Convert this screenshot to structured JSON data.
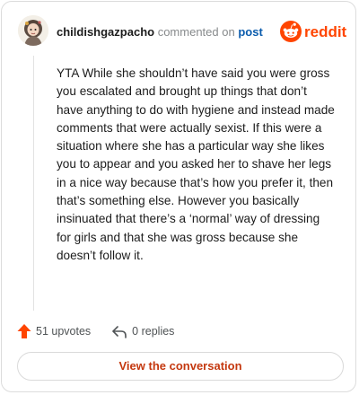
{
  "header": {
    "author": "childishgazpacho",
    "action_text": "commented on",
    "target_link": "post"
  },
  "brand": {
    "wordmark": "reddit",
    "accent_color": "#ff4500"
  },
  "comment": {
    "text": "YTA While she shouldn’t have said you were gross you escalated and brought up things that don’t have anything to do with hygiene and instead made comments that were actually sexist. If this were a situation where she has a particular way she likes you to appear and you asked her to shave her legs in a nice way because that’s how you prefer it, then that’s something else. However you basically insinuated that there’s a ‘normal’ way of dressing for girls and that she was gross because she doesn’t follow it."
  },
  "stats": {
    "upvotes_label": "51 upvotes",
    "replies_label": "0 replies",
    "upvote_icon": "upvote-arrow-icon",
    "reply_icon": "reply-arrow-icon"
  },
  "cta": {
    "label": "View the conversation",
    "color": "#c4380f"
  }
}
